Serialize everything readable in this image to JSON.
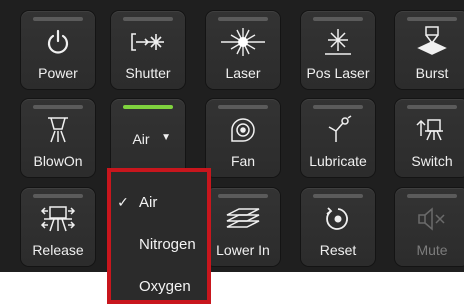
{
  "buttons": {
    "power": "Power",
    "shutter": "Shutter",
    "laser": "Laser",
    "pos_laser": "Pos Laser",
    "burst": "Burst",
    "blowon": "BlowOn",
    "air_select": "Air",
    "fan": "Fan",
    "lubricate": "Lubricate",
    "switch": "Switch",
    "release": "Release",
    "lower_in": "Lower In",
    "reset": "Reset",
    "mute": "Mute"
  },
  "gas_dropdown": {
    "options": [
      "Air",
      "Nitrogen",
      "Oxygen"
    ],
    "selected": "Air",
    "check_mark": "✓"
  },
  "colors": {
    "highlight_border": "#c8161d",
    "active_indicator": "#7fd23e"
  }
}
